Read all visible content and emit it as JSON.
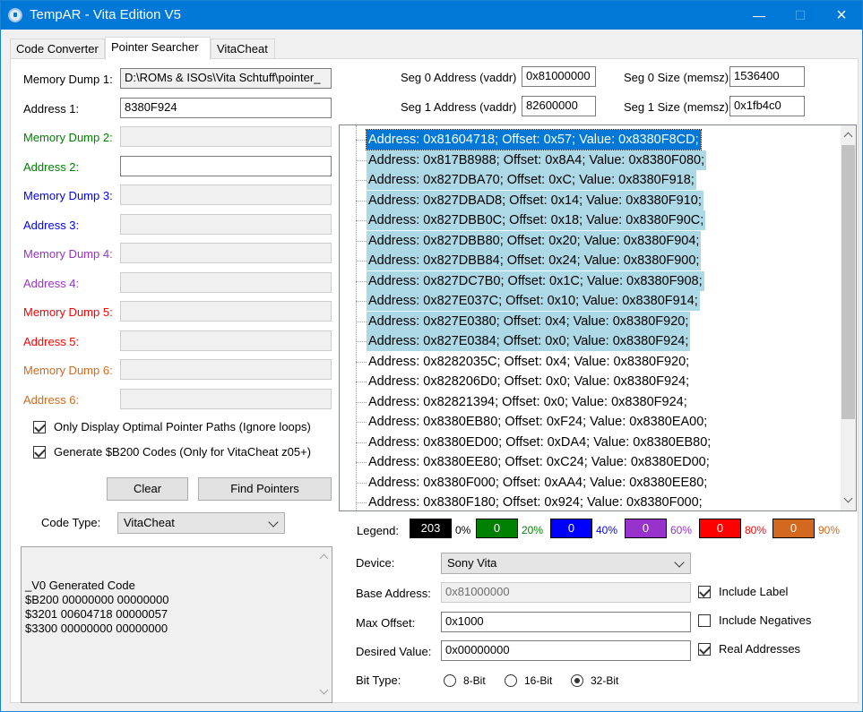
{
  "window": {
    "title": "TempAR - Vita Edition  V5"
  },
  "tabs": [
    "Code Converter",
    "Pointer Searcher",
    "VitaCheat"
  ],
  "left": {
    "dumps": [
      {
        "dump_label": "Memory Dump 1:",
        "dump_value": "D:\\ROMs & ISOs\\Vita Schtuff\\pointer_",
        "addr_label": "Address 1:",
        "addr_value": "8380F924",
        "color": "#000000"
      },
      {
        "dump_label": "Memory Dump 2:",
        "dump_value": "",
        "addr_label": "Address 2:",
        "addr_value": "",
        "color": "#008000"
      },
      {
        "dump_label": "Memory Dump 3:",
        "dump_value": "",
        "addr_label": "Address 3:",
        "addr_value": "",
        "color": "#0000ff"
      },
      {
        "dump_label": "Memory Dump 4:",
        "dump_value": "",
        "addr_label": "Address 4:",
        "addr_value": "",
        "color": "#9932cc"
      },
      {
        "dump_label": "Memory Dump 5:",
        "dump_value": "",
        "addr_label": "Address 5:",
        "addr_value": "",
        "color": "#ff0000"
      },
      {
        "dump_label": "Memory Dump 6:",
        "dump_value": "",
        "addr_label": "Address 6:",
        "addr_value": "",
        "color": "#d2691e"
      }
    ],
    "opt_optimal": "Only Display Optimal Pointer Paths (Ignore loops)",
    "opt_b200": "Generate $B200 Codes (Only for VitaCheat z05+)",
    "clear_btn": "Clear",
    "find_btn": "Find Pointers",
    "code_type_label": "Code Type:",
    "code_type_value": "VitaCheat",
    "code_output": "_V0 Generated Code\n$B200 00000000 00000000\n$3201 00604718 00000057\n$3300 00000000 00000000"
  },
  "seg": {
    "seg0_addr_label": "Seg 0 Address (vaddr)",
    "seg0_addr": "0x81000000",
    "seg0_size_label": "Seg 0 Size (memsz)",
    "seg0_size": "1536400",
    "seg1_addr_label": "Seg 1 Address (vaddr)",
    "seg1_addr": "82600000",
    "seg1_size_label": "Seg 1 Size (memsz)",
    "seg1_size": "0x1fb4c0"
  },
  "results": [
    {
      "text": "Address: 0x81604718; Offset: 0x57; Value: 0x8380F8CD;",
      "state": "sel"
    },
    {
      "text": "Address: 0x817B8988; Offset: 0x8A4; Value: 0x8380F080;",
      "state": "hl"
    },
    {
      "text": "Address: 0x827DBA70; Offset: 0xC; Value: 0x8380F918;",
      "state": "hl"
    },
    {
      "text": "Address: 0x827DBAD8; Offset: 0x14; Value: 0x8380F910;",
      "state": "hl"
    },
    {
      "text": "Address: 0x827DBB0C; Offset: 0x18; Value: 0x8380F90C;",
      "state": "hl"
    },
    {
      "text": "Address: 0x827DBB80; Offset: 0x20; Value: 0x8380F904;",
      "state": "hl"
    },
    {
      "text": "Address: 0x827DBB84; Offset: 0x24; Value: 0x8380F900;",
      "state": "hl"
    },
    {
      "text": "Address: 0x827DC7B0; Offset: 0x1C; Value: 0x8380F908;",
      "state": "hl"
    },
    {
      "text": "Address: 0x827E037C; Offset: 0x10; Value: 0x8380F914;",
      "state": "hl"
    },
    {
      "text": "Address: 0x827E0380; Offset: 0x4; Value: 0x8380F920;",
      "state": "hl"
    },
    {
      "text": "Address: 0x827E0384; Offset: 0x0; Value: 0x8380F924;",
      "state": "hl"
    },
    {
      "text": "Address: 0x8282035C; Offset: 0x4; Value: 0x8380F920;",
      "state": ""
    },
    {
      "text": "Address: 0x828206D0; Offset: 0x0; Value: 0x8380F924;",
      "state": ""
    },
    {
      "text": "Address: 0x82821394; Offset: 0x0; Value: 0x8380F924;",
      "state": ""
    },
    {
      "text": "Address: 0x8380EB80; Offset: 0xF24; Value: 0x8380EA00;",
      "state": ""
    },
    {
      "text": "Address: 0x8380ED00; Offset: 0xDA4; Value: 0x8380EB80;",
      "state": ""
    },
    {
      "text": "Address: 0x8380EE80; Offset: 0xC24; Value: 0x8380ED00;",
      "state": ""
    },
    {
      "text": "Address: 0x8380F000; Offset: 0xAA4; Value: 0x8380EE80;",
      "state": ""
    },
    {
      "text": "Address: 0x8380F180; Offset: 0x924; Value: 0x8380F000;",
      "state": ""
    }
  ],
  "legend": {
    "label": "Legend:",
    "items": [
      {
        "value": "203",
        "pct": "0%",
        "bg": "#000000",
        "pct_color": "#000000"
      },
      {
        "value": "0",
        "pct": "20%",
        "bg": "#008000",
        "pct_color": "#008000"
      },
      {
        "value": "0",
        "pct": "40%",
        "bg": "#0000ff",
        "pct_color": "#0000ff"
      },
      {
        "value": "0",
        "pct": "60%",
        "bg": "#9932cc",
        "pct_color": "#9932cc"
      },
      {
        "value": "0",
        "pct": "80%",
        "bg": "#ff0000",
        "pct_color": "#ff0000"
      },
      {
        "value": "0",
        "pct": "90%",
        "bg": "#d2691e",
        "pct_color": "#d2691e"
      }
    ]
  },
  "settings": {
    "device_label": "Device:",
    "device_value": "Sony Vita",
    "base_label": "Base Address:",
    "base_value": "0x81000000",
    "maxoff_label": "Max Offset:",
    "maxoff_value": "0x1000",
    "desired_label": "Desired Value:",
    "desired_value": "0x00000000",
    "include_label": "Include Label",
    "include_negatives": "Include Negatives",
    "real_addresses": "Real Addresses",
    "bit_type_label": "Bit Type:",
    "bit_8": "8-Bit",
    "bit_16": "16-Bit",
    "bit_32": "32-Bit"
  }
}
